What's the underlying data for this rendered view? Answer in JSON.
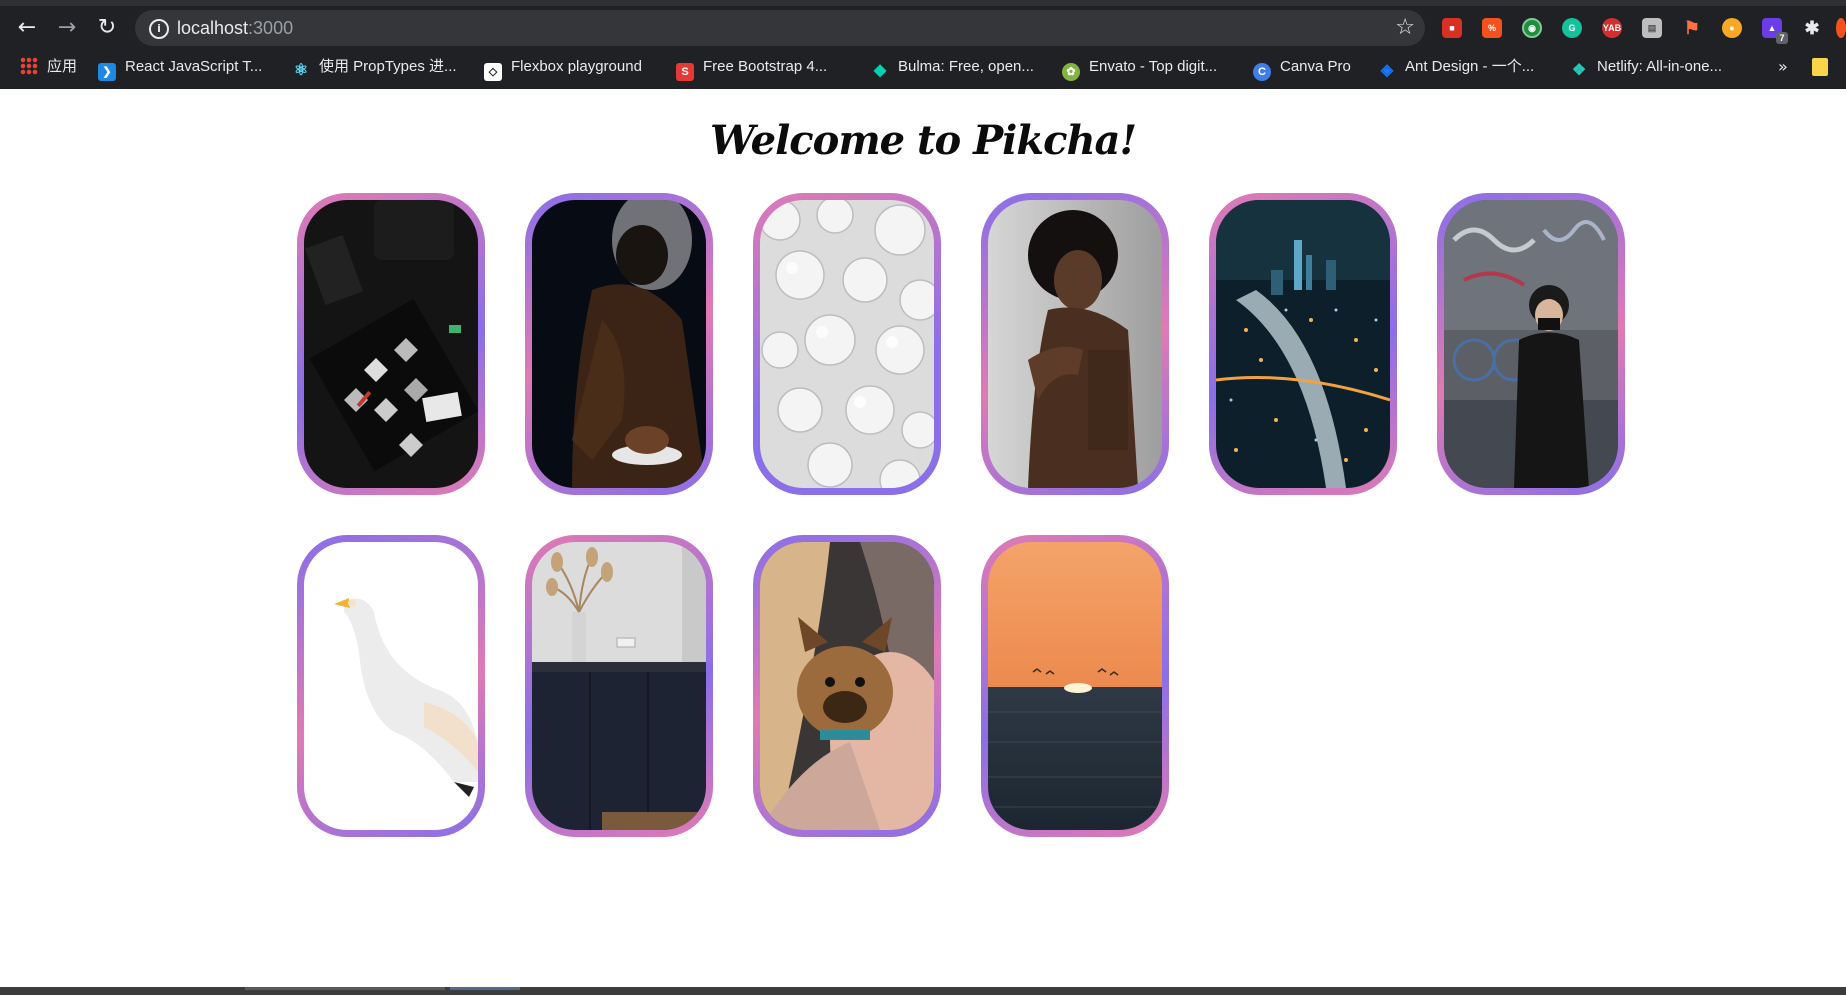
{
  "browser": {
    "url_host": "localhost",
    "url_port": ":3000",
    "bookmarks": [
      {
        "label": "应用",
        "icon": "apps-grid-icon"
      },
      {
        "label": "React JavaScript T...",
        "icon": "vscode-icon"
      },
      {
        "label": "使用 PropTypes 进...",
        "icon": "react-icon"
      },
      {
        "label": "Flexbox playground",
        "icon": "flexbox-icon"
      },
      {
        "label": "Free Bootstrap 4...",
        "icon": "s-logo-icon"
      },
      {
        "label": "Bulma: Free, open...",
        "icon": "bulma-icon"
      },
      {
        "label": "Envato - Top digit...",
        "icon": "envato-icon"
      },
      {
        "label": "Canva Pro",
        "icon": "canva-icon"
      },
      {
        "label": "Ant Design - 一个...",
        "icon": "ant-design-icon"
      },
      {
        "label": "Netlify: All-in-one...",
        "icon": "netlify-icon"
      }
    ],
    "more_label": "»",
    "extension_badge": "7"
  },
  "page": {
    "title": "Welcome to Pikcha!"
  },
  "gallery": {
    "cards": [
      {
        "subject": "dark flatlay with cosmetics"
      },
      {
        "subject": "person in brown sweater in darkness"
      },
      {
        "subject": "silver christmas ornaments"
      },
      {
        "subject": "shirtless man with afro"
      },
      {
        "subject": "city at night from above"
      },
      {
        "subject": "woman with mask by graffiti wall"
      },
      {
        "subject": "white swan"
      },
      {
        "subject": "kitchen with dried pampas grass"
      },
      {
        "subject": "woman hugging french bulldog"
      },
      {
        "subject": "sunset over the sea"
      }
    ]
  },
  "colors": {
    "chrome_bg": "#202124",
    "omnibox_bg": "#35363a",
    "card_gradient_purple": "#8a6fe8",
    "card_gradient_pink": "#e07ab4",
    "page_bg": "#ffffff"
  }
}
